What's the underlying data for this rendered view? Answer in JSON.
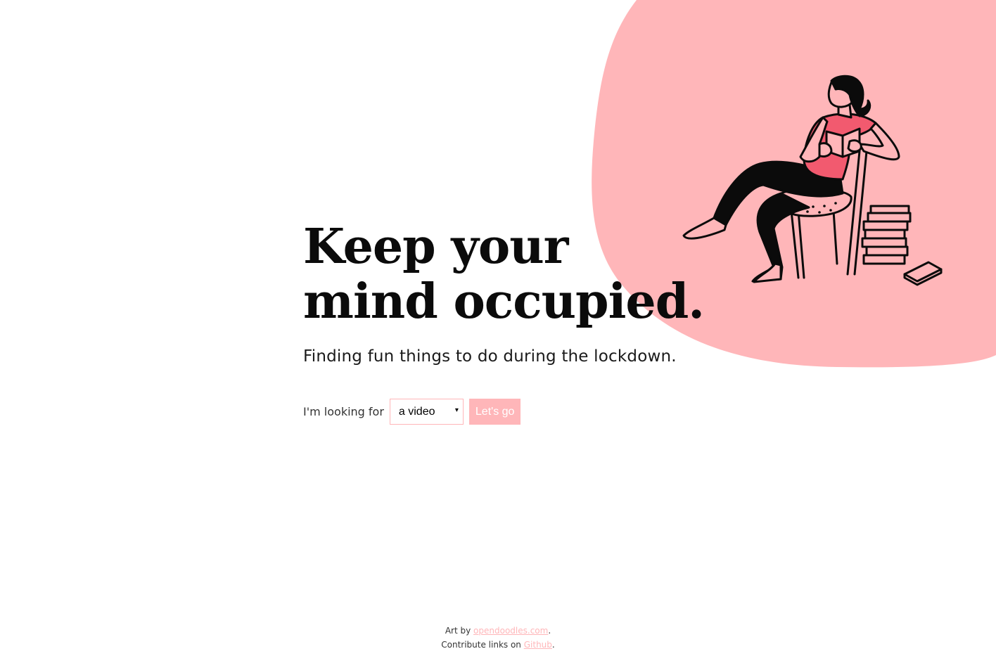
{
  "colors": {
    "accent": "#ffb6b9",
    "shirt": "#f25a6f",
    "ink": "#0b0b0b",
    "background": "#ffffff"
  },
  "hero": {
    "title_line1": "Keep your",
    "title_line2": "mind occupied.",
    "subtitle": "Finding fun things to do during the lockdown."
  },
  "search": {
    "label": "I'm looking for",
    "select_value": "a video",
    "select_caret": "▾",
    "button_label": "Let's go"
  },
  "illustration": {
    "icon": "person-reading-in-chair-illustration"
  },
  "footer": {
    "line1_prefix": "Art by ",
    "line1_link": "opendoodles.com",
    "line1_suffix": ".",
    "line2_prefix": "Contribute links on ",
    "line2_link": "Github",
    "line2_suffix": "."
  }
}
